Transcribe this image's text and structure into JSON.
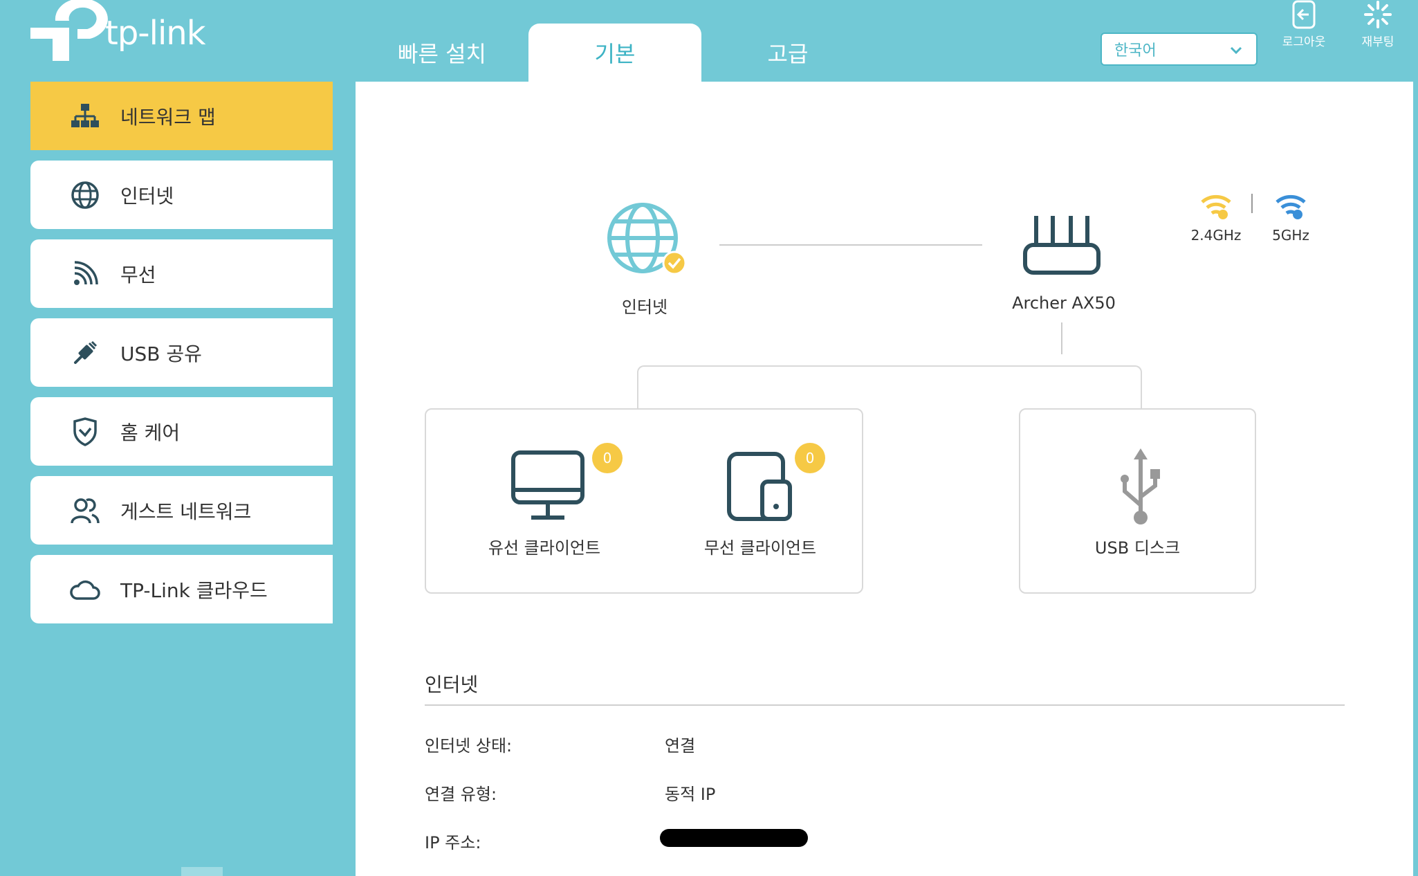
{
  "header": {
    "brand": "tp-link",
    "tabs": [
      {
        "label": "빠른 설치",
        "active": false
      },
      {
        "label": "기본",
        "active": true
      },
      {
        "label": "고급",
        "active": false
      }
    ],
    "language": {
      "selected": "한국어"
    },
    "logout_label": "로그아웃",
    "reboot_label": "재부팅"
  },
  "sidebar": {
    "items": [
      {
        "label": "네트워크 맵",
        "icon": "network-map-icon",
        "active": true
      },
      {
        "label": "인터넷",
        "icon": "globe-icon",
        "active": false
      },
      {
        "label": "무선",
        "icon": "wireless-icon",
        "active": false
      },
      {
        "label": "USB 공유",
        "icon": "usb-icon",
        "active": false
      },
      {
        "label": "홈 케어",
        "icon": "shield-icon",
        "active": false
      },
      {
        "label": "게스트 네트워크",
        "icon": "guests-icon",
        "active": false
      },
      {
        "label": "TP-Link 클라우드",
        "icon": "cloud-icon",
        "active": false
      }
    ]
  },
  "network_map": {
    "internet_label": "인터넷",
    "router_label": "Archer AX50",
    "band_24": "2.4GHz",
    "band_5": "5GHz",
    "wired_clients": {
      "label": "유선 클라이언트",
      "count": "0"
    },
    "wireless_clients": {
      "label": "무선 클라이언트",
      "count": "0"
    },
    "usb_disk": {
      "label": "USB 디스크"
    }
  },
  "internet_section": {
    "title": "인터넷",
    "rows": [
      {
        "key": "인터넷 상태:",
        "value": "연결"
      },
      {
        "key": "연결 유형:",
        "value": "동적 IP"
      },
      {
        "key": "IP 주소:",
        "value": ""
      }
    ]
  },
  "colors": {
    "background": "#72c9d6",
    "active_nav": "#f6c945",
    "accent": "#3cb3c4",
    "badge": "#f6c945",
    "icon_dark": "#2e4f5c",
    "wifi_24": "#f6c945",
    "wifi_5": "#3a8fd8"
  }
}
